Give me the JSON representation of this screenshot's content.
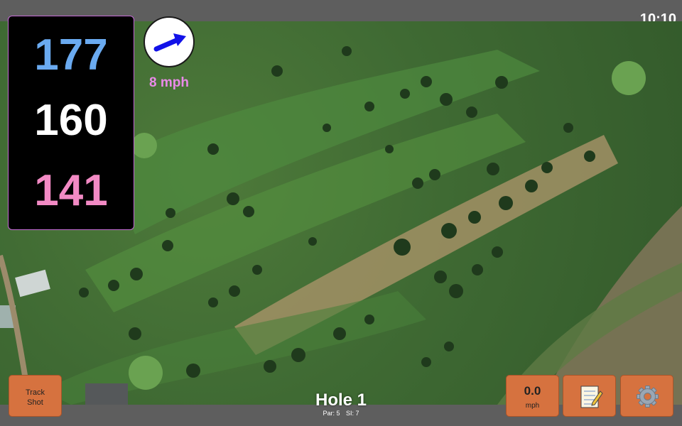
{
  "status_bar": {
    "time": "10:10"
  },
  "distances": {
    "back": "177",
    "middle": "160",
    "front": "141"
  },
  "wind": {
    "speed": "8 mph",
    "direction_icon": "arrow-up-right-icon"
  },
  "buttons": {
    "track_shot_line1": "Track",
    "track_shot_line2": "Shot",
    "speed_value": "0.0",
    "speed_unit": "mph",
    "notes_icon": "notepad-icon",
    "settings_icon": "gear-icon"
  },
  "hole": {
    "title": "Hole 1",
    "par": "Par: 5",
    "si": "SI: 7"
  },
  "colors": {
    "back_distance": "#6aaaf0",
    "middle_distance": "#ffffff",
    "front_distance": "#f28ac4",
    "wind_speed": "#e98ae8",
    "button_bg": "#d6723f",
    "wind_arrow": "#1212e8"
  }
}
